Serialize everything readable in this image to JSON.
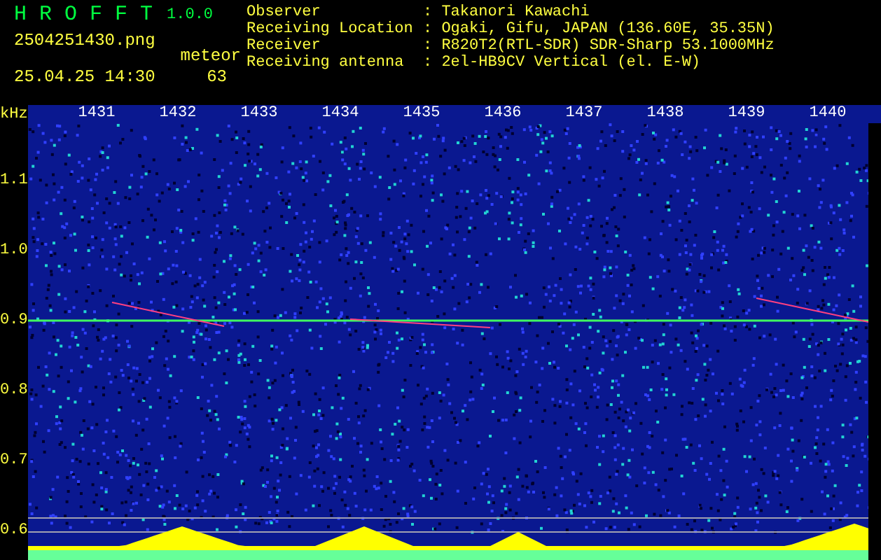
{
  "header": {
    "app_name": "H R O F F T",
    "version": "1.0.0",
    "filename": "2504251430.png",
    "datetime": "25.04.25 14:30",
    "detection_label": "meteor",
    "detection_count": "63"
  },
  "station_info": [
    {
      "label": "Observer",
      "value": ": Takanori Kawachi"
    },
    {
      "label": "Receiving Location",
      "value": ": Ogaki, Gifu, JAPAN (136.60E, 35.35N)"
    },
    {
      "label": "Receiver",
      "value": ": R820T2(RTL-SDR) SDR-Sharp 53.1000MHz"
    },
    {
      "label": "Receiving antenna",
      "value": ": 2el-HB9CV Vertical (el. E-W)"
    }
  ],
  "spectrogram": {
    "x_unit": "kHz",
    "x_ticks": [
      "1431",
      "1432",
      "1433",
      "1434",
      "1435",
      "1436",
      "1437",
      "1438",
      "1439",
      "1440"
    ],
    "y_ticks": [
      "1.1",
      "1.0",
      "0.9",
      "0.8",
      "0.7",
      "0.6"
    ]
  }
}
